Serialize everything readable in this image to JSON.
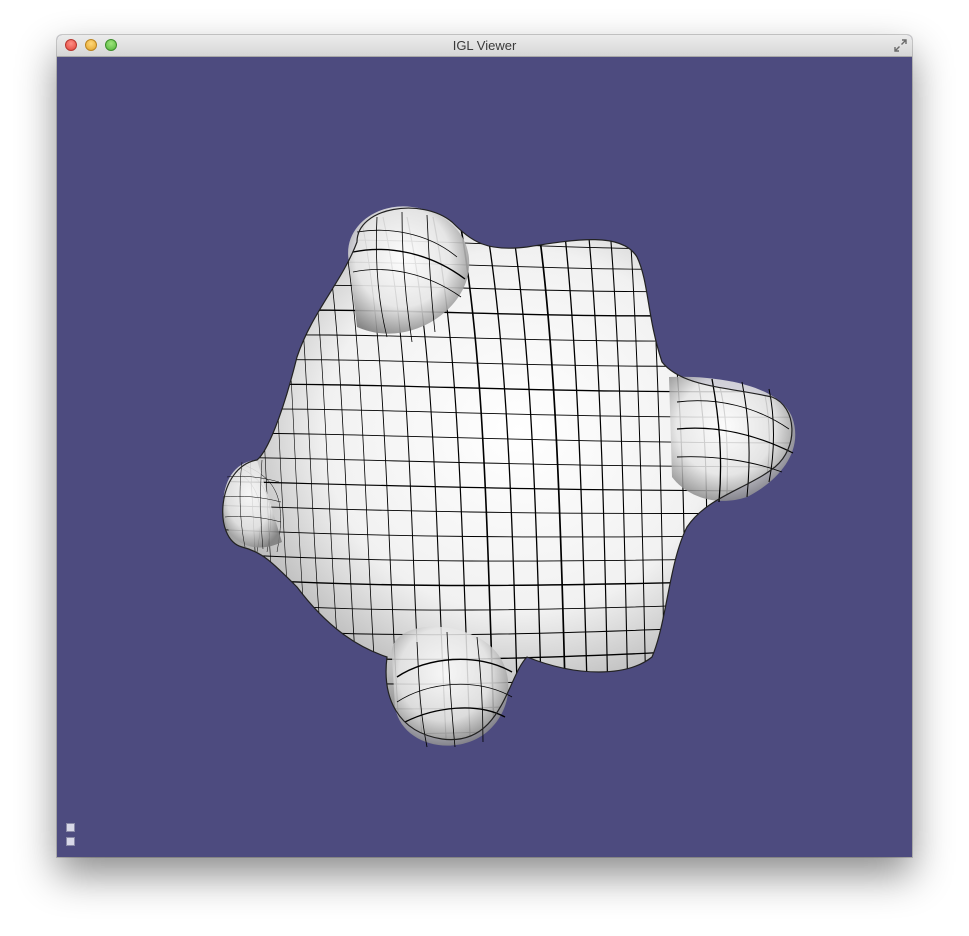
{
  "window": {
    "title": "IGL Viewer"
  },
  "viewport": {
    "background_color": "#4d4b7f",
    "mesh_color": "#f4f4f4",
    "wire_color": "#000000"
  },
  "icons": {
    "close": "close-icon",
    "minimize": "minimize-icon",
    "zoom": "zoom-icon",
    "fullscreen": "fullscreen-icon",
    "corner_buttons": [
      "panel-toggle-icon",
      "panel-toggle-icon"
    ]
  }
}
